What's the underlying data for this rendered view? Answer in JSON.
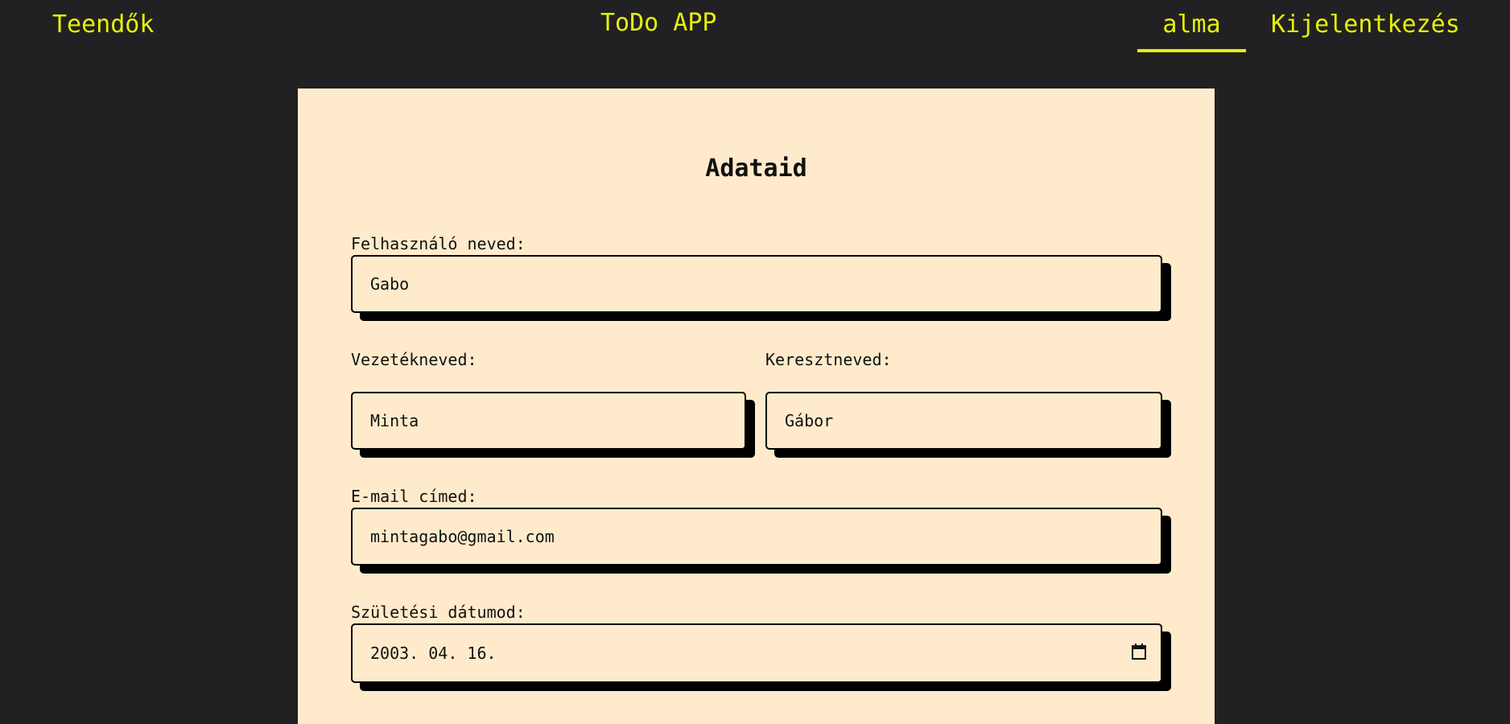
{
  "nav": {
    "todos_link": "Teendők",
    "app_title": "ToDo APP",
    "user_link": "alma",
    "logout_link": "Kijelentkezés",
    "accent_color": "#e6f00a",
    "background_color": "#212123"
  },
  "profile_form": {
    "title": "Adataid",
    "card_color": "#ffebcc",
    "username": {
      "label": "Felhasználó neved:",
      "value": "Gabo"
    },
    "last_name": {
      "label": "Vezetékneved:",
      "value": "Minta"
    },
    "first_name": {
      "label": "Keresztneved:",
      "value": "Gábor"
    },
    "email": {
      "label": "E-mail címed:",
      "value": "mintagabo@gmail.com"
    },
    "birth_date": {
      "label": "Születési dátumod:",
      "value": "2003. 04. 16.",
      "icon": "calendar-icon"
    }
  }
}
